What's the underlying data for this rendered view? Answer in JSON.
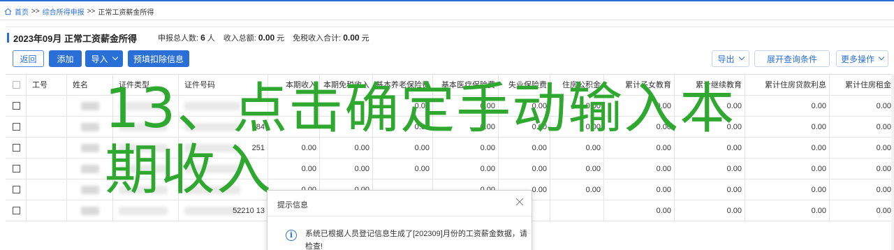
{
  "breadcrumb": {
    "home": "首页",
    "sep1": ">>",
    "parent": "综合所得申报",
    "sep2": ">>",
    "current": "正常工资薪金所得"
  },
  "header": {
    "title": "2023年09月  正常工资薪金所得",
    "people_label": "申报总人数:",
    "people_value": "6",
    "people_unit": "人",
    "income_label": "收入总额:",
    "income_value": "0.00",
    "income_unit": "元",
    "taxfree_label": "免税收入合计:",
    "taxfree_value": "0.00",
    "taxfree_unit": "元"
  },
  "toolbar": {
    "back": "返回",
    "add": "添加",
    "import": "导入",
    "prefill": "预填扣除信息",
    "export": "导出",
    "expand": "展开查询条件",
    "more": "更多操作"
  },
  "table": {
    "columns": [
      "工号",
      "姓名",
      "证件类型",
      "证件号码",
      "本期收入",
      "本期免税收入",
      "基本养老保险费",
      "基本医疗保险费",
      "失业保险费",
      "住房公积金",
      "累计子女教育",
      "累计继续教育",
      "累计住房贷款利息",
      "累计住房租金"
    ],
    "rows": [
      {
        "id_fragment": "",
        "values": [
          "",
          "",
          "0.00",
          "0.00",
          "0.00",
          "0.00",
          "0.00",
          "0.00",
          "0.00",
          "0.00"
        ]
      },
      {
        "id_fragment": "84",
        "values": [
          "",
          "",
          "0.00",
          "0.00",
          "0.00",
          "0.00",
          "0.00",
          "0.00",
          "0.00",
          "0.00"
        ]
      },
      {
        "id_fragment": "251",
        "values": [
          "0.00",
          "0.00",
          "0.00",
          "0.00",
          "0.00",
          "0.00",
          "0.00",
          "0.00",
          "0.00",
          "0.00"
        ]
      },
      {
        "id_fragment": "",
        "values": [
          "0.00",
          "0.00",
          "0.00",
          "0.00",
          "0.00",
          "0.00",
          "0.00",
          "0.00",
          "0.00",
          "0.00"
        ]
      },
      {
        "id_fragment": "",
        "values": [
          "0.00",
          "0.00",
          "",
          "0.00",
          "0.00",
          "0.00",
          "0.00",
          "0.00",
          "0.00",
          "0.00"
        ]
      },
      {
        "id_fragment": "52210          13",
        "values": [
          "",
          "",
          "",
          "",
          "",
          "",
          "0.00",
          "0.00",
          "0.00",
          "0.00"
        ]
      }
    ]
  },
  "overlay": {
    "line1": "13、点击确定手动输入本",
    "line2": "期收入"
  },
  "dialog": {
    "title": "提示信息",
    "message": "系统已根据人员登记信息生成了[202309]月份的工资薪金数据，请检查!"
  },
  "colors": {
    "accent": "#2a6fd6",
    "overlay_green": "#2fa830"
  },
  "icons": {
    "home": "home-icon",
    "close": "close-icon",
    "info": "info-icon",
    "dropdown": "chevron-down-icon"
  }
}
